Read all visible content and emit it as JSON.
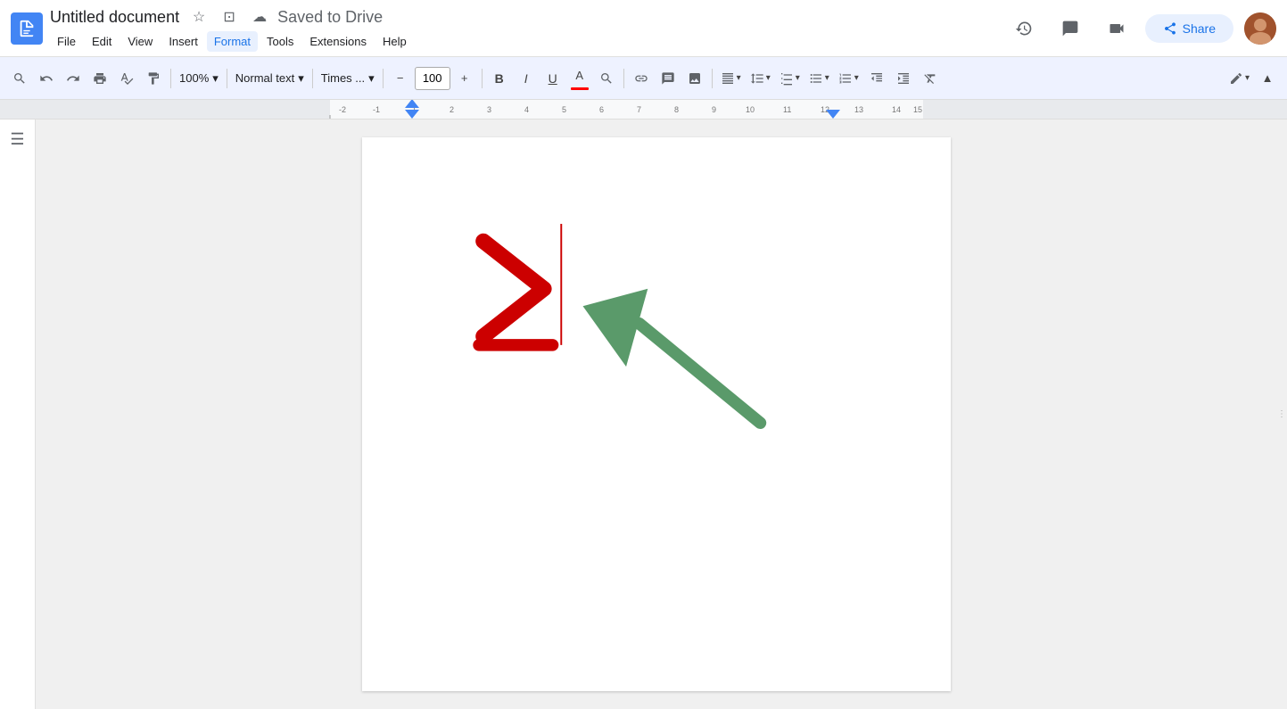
{
  "titleBar": {
    "docTitle": "Untitled document",
    "savedText": "Saved to Drive",
    "menuItems": [
      "File",
      "Edit",
      "View",
      "Insert",
      "Format",
      "Tools",
      "Extensions",
      "Help"
    ]
  },
  "toolbar": {
    "zoom": "100%",
    "zoomValue": "100",
    "normalText": "Normal text",
    "font": "Times ...",
    "fontSize": "100",
    "buttons": {
      "search": "🔍",
      "undo": "↩",
      "redo": "↪",
      "print": "🖨",
      "spellcheck": "✓",
      "paintFormat": "🖊",
      "bold": "B",
      "italic": "I",
      "underline": "U",
      "fontColor": "A",
      "highlight": "✏",
      "link": "🔗",
      "comment": "💬",
      "image": "🖼",
      "align": "≡",
      "lineSpacing": "↕",
      "checklist": "☑",
      "bulletList": "•",
      "numberedList": "1",
      "indent": "→",
      "outdent": "←",
      "clearFormat": "✕",
      "pen": "✏",
      "collapse": "^"
    }
  },
  "drawing": {
    "redSymbol": "≥",
    "cursorColor": "#ff0000",
    "arrowColor": "#5a9a6a"
  },
  "colors": {
    "toolbar_bg": "#eef2ff",
    "page_bg": "#ffffff",
    "doc_area_bg": "#f0f0f0",
    "accent": "#4285f4",
    "share_bg": "#e8f0fe",
    "share_color": "#1a73e8",
    "red": "#e00000",
    "green_arrow": "#5a9a6a"
  }
}
